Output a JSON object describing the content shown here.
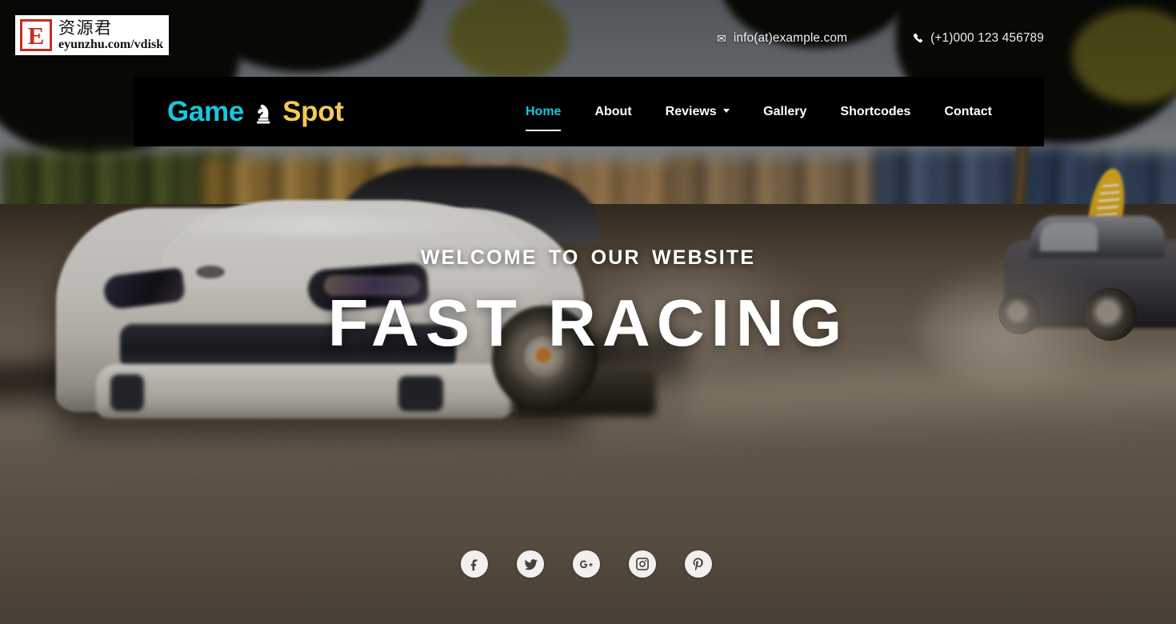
{
  "topbar": {
    "email": {
      "icon": "envelope-icon",
      "text": "info(at)example.com",
      "glyph": "✉"
    },
    "phone": {
      "icon": "phone-icon",
      "text": "(+1)000 123 456789",
      "glyph": "✆"
    }
  },
  "watermark": {
    "letter": "E",
    "chinese": "资源君",
    "url": "eyunzhu.com/vdisk",
    "box_color": "#ffffff",
    "letter_color": "#cc2b1d"
  },
  "navbar": {
    "brand": {
      "first": "Game",
      "second": "Spot",
      "icon": "chess-knight-icon",
      "first_color": "#19c6de",
      "second_color": "#f4c954"
    },
    "background": "#000000",
    "menu": [
      {
        "label": "Home",
        "active": true,
        "has_dropdown": false
      },
      {
        "label": "About",
        "active": false,
        "has_dropdown": false
      },
      {
        "label": "Reviews",
        "active": false,
        "has_dropdown": true
      },
      {
        "label": "Gallery",
        "active": false,
        "has_dropdown": false
      },
      {
        "label": "Shortcodes",
        "active": false,
        "has_dropdown": false
      },
      {
        "label": "Contact",
        "active": false,
        "has_dropdown": false
      }
    ]
  },
  "hero": {
    "eyebrow": "WELCOME  TO  OUR  WEBSITE",
    "headline": "FAST RACING",
    "background_description": "white sports car racing on a road with motion blur"
  },
  "social": [
    {
      "name": "facebook-icon",
      "label": "Facebook"
    },
    {
      "name": "twitter-icon",
      "label": "Twitter"
    },
    {
      "name": "google-plus-icon",
      "label": "Google Plus"
    },
    {
      "name": "instagram-icon",
      "label": "Instagram"
    },
    {
      "name": "pinterest-icon",
      "label": "Pinterest"
    }
  ]
}
